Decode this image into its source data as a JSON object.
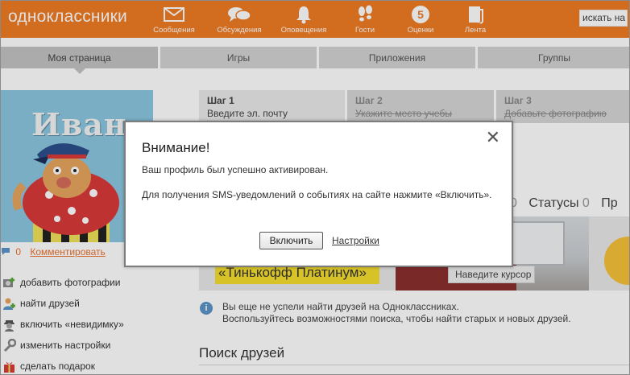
{
  "header": {
    "logo": "одноклассники",
    "nav": [
      {
        "label": "Сообщения",
        "icon": "envelope-icon"
      },
      {
        "label": "Обсуждения",
        "icon": "chat-bubbles-icon"
      },
      {
        "label": "Оповещения",
        "icon": "bell-icon"
      },
      {
        "label": "Гости",
        "icon": "footprints-icon"
      },
      {
        "label": "Оценки",
        "icon": "rating-circle-icon",
        "badge": "5"
      },
      {
        "label": "Лента",
        "icon": "news-feed-icon"
      }
    ],
    "search_placeholder": "искать на"
  },
  "tabs": [
    {
      "label": "Моя страница",
      "active": true
    },
    {
      "label": "Игры"
    },
    {
      "label": "Приложения"
    },
    {
      "label": "Группы"
    }
  ],
  "profile": {
    "avatar_name": "Иван",
    "comment_count": "0",
    "comment_link": "Комментировать"
  },
  "side_menu": [
    {
      "label": "добавить фотографии",
      "icon": "add-photo-icon"
    },
    {
      "label": "найти друзей",
      "icon": "find-friends-icon"
    },
    {
      "label": "включить «невидимку»",
      "icon": "invisible-icon"
    },
    {
      "label": "изменить настройки",
      "icon": "wrench-icon"
    },
    {
      "label": "сделать подарок",
      "icon": "gift-icon"
    }
  ],
  "steps": [
    {
      "title": "Шаг 1",
      "desc": "Введите эл. почту",
      "state": "active"
    },
    {
      "title": "Шаг 2",
      "desc": "Укажите место учебы",
      "state": "done"
    },
    {
      "title": "Шаг 3",
      "desc": "Добавьте фотографию",
      "state": "done"
    }
  ],
  "statuses": {
    "count1": "0",
    "label": "Статусы",
    "count2": "0",
    "next": "Пр"
  },
  "banner": {
    "text": "«Тинькофф Платинум»",
    "hover_hint": "Наведите курсор"
  },
  "info": {
    "line1": "Вы еще не успели найти друзей на Одноклассниках.",
    "line2": "Воспользуйтесь возможностями поиска, чтобы найти старых и новых друзей."
  },
  "friends_search_title": "Поиск друзей",
  "dialog": {
    "title": "Внимание!",
    "message1": "Ваш профиль был успешно активирован.",
    "message2": "Для получения SMS-уведомлений о событиях на сайте нажмите «Включить».",
    "confirm_label": "Включить",
    "settings_label": "Настройки",
    "close_glyph": "✕"
  },
  "colors": {
    "brand_orange": "#f07b23",
    "link_orange": "#eb722e",
    "banner_yellow": "#f5df2e"
  }
}
